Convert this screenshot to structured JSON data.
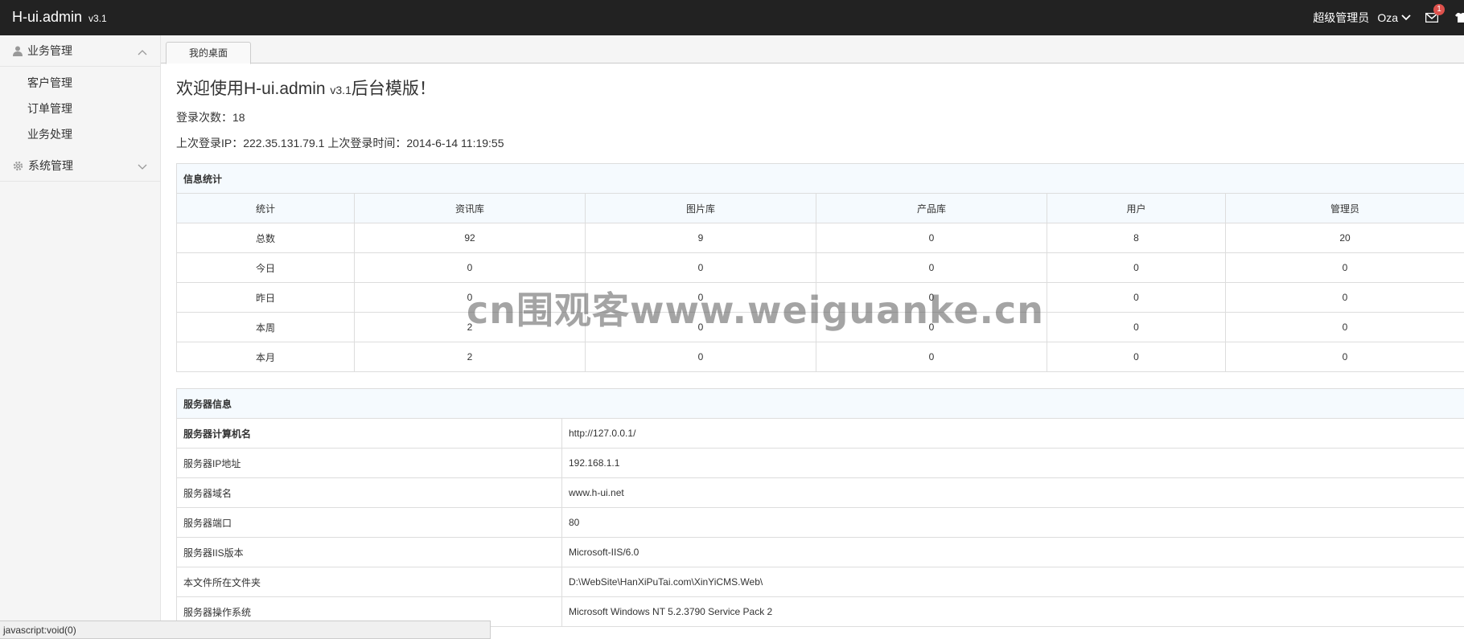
{
  "topbar": {
    "brand": "H-ui.admin",
    "version": "v3.1",
    "role": "超级管理员",
    "username": "Oza",
    "message_count": "1"
  },
  "sidebar": {
    "groups": [
      {
        "label": "业务管理",
        "icon": "user-icon",
        "expanded": true,
        "items": [
          {
            "label": "客户管理"
          },
          {
            "label": "订单管理"
          },
          {
            "label": "业务处理"
          }
        ]
      },
      {
        "label": "系统管理",
        "icon": "gear-icon",
        "expanded": false,
        "items": []
      }
    ]
  },
  "tabs": [
    {
      "label": "我的桌面"
    }
  ],
  "welcome": {
    "title_prefix": "欢迎使用H-ui.admin",
    "title_version": "v3.1",
    "title_suffix": "后台模版！",
    "login_count": "登录次数：18",
    "last_login": "上次登录IP：222.35.131.79.1  上次登录时间：2014-6-14 11:19:55"
  },
  "stats": {
    "title": "信息统计",
    "columns": [
      "统计",
      "资讯库",
      "图片库",
      "产品库",
      "用户",
      "管理员"
    ],
    "rows": [
      [
        "总数",
        "92",
        "9",
        "0",
        "8",
        "20"
      ],
      [
        "今日",
        "0",
        "0",
        "0",
        "0",
        "0"
      ],
      [
        "昨日",
        "0",
        "0",
        "0",
        "0",
        "0"
      ],
      [
        "本周",
        "2",
        "0",
        "0",
        "0",
        "0"
      ],
      [
        "本月",
        "2",
        "0",
        "0",
        "0",
        "0"
      ]
    ]
  },
  "server": {
    "title": "服务器信息",
    "rows": [
      [
        "服务器计算机名",
        "http://127.0.0.1/"
      ],
      [
        "服务器IP地址",
        "192.168.1.1"
      ],
      [
        "服务器域名",
        "www.h-ui.net"
      ],
      [
        "服务器端口",
        "80"
      ],
      [
        "服务器IIS版本",
        "Microsoft-IIS/6.0"
      ],
      [
        "本文件所在文件夹",
        "D:\\WebSite\\HanXiPuTai.com\\XinYiCMS.Web\\"
      ],
      [
        "服务器操作系统",
        "Microsoft Windows NT 5.2.3790 Service Pack 2"
      ]
    ]
  },
  "statusbar": "javascript:void(0)",
  "watermark": "cn围观客www.weiguanke.cn"
}
